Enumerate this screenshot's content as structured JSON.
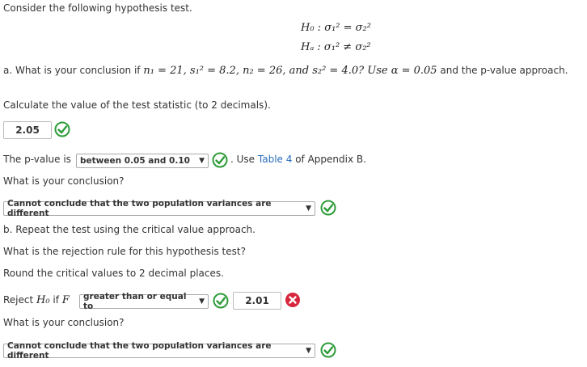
{
  "intro": "Consider the following hypothesis test.",
  "hypotheses": {
    "h0": "H₀ : σ₁² = σ₂²",
    "ha": "Hₐ : σ₁² ≠ σ₂²"
  },
  "part_a": {
    "question_prefix": "a. What is your conclusion if",
    "question_math": "n₁ = 21, s₁² = 8.2, n₂ = 26, and s₂² = 4.0? Use α = 0.05",
    "question_suffix": "and the p-value approach.",
    "calc_prompt": "Calculate the value of the test statistic (to 2 decimals).",
    "test_stat_value": "2.05",
    "pvalue_prefix": "The p-value is",
    "pvalue_selected": "between 0.05 and 0.10",
    "pvalue_suffix_pre": ". Use",
    "pvalue_link": "Table 4",
    "pvalue_suffix_post": "of Appendix B.",
    "conclusion_prompt": "What is your conclusion?",
    "conclusion_selected": "Cannot conclude that the two population variances are different"
  },
  "part_b": {
    "heading": "b. Repeat the test using the critical value approach.",
    "rule_prompt": "What is the rejection rule for this hypothesis test?",
    "round_prompt": "Round the critical values to 2 decimal places.",
    "reject_prefix": "Reject",
    "reject_h0": "H₀",
    "reject_if": "if",
    "reject_f": "F",
    "rule_selected": "greater than or equal to",
    "critical_value": "2.01",
    "conclusion_prompt": "What is your conclusion?",
    "conclusion_selected": "Cannot conclude that the two population variances are different"
  },
  "colors": {
    "correct": "#2e9c3a",
    "incorrect": "#d7263d",
    "link": "#2a6ebb"
  }
}
